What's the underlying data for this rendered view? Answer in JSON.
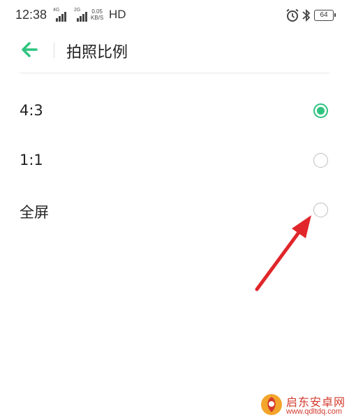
{
  "status_bar": {
    "time": "12:38",
    "signal_1_tag": "4G",
    "signal_2_tag": "2G",
    "speed_value": "0.05",
    "speed_unit": "KB/S",
    "hd_label": "HD",
    "battery_level": "64",
    "icons": [
      "alarm-icon",
      "bluetooth-icon",
      "battery-icon"
    ]
  },
  "header": {
    "title": "拍照比例",
    "back_icon": "arrow-left-icon"
  },
  "options": [
    {
      "label": "4:3",
      "selected": true
    },
    {
      "label": "1:1",
      "selected": false
    },
    {
      "label": "全屏",
      "selected": false
    }
  ],
  "watermark": {
    "name": "启东安卓网",
    "url": "www.qdltdq.com"
  },
  "colors": {
    "accent": "#2dc47e",
    "annotation": "#e0262a",
    "radio_off": "#bfbfbf",
    "watermark": "#d33a2c"
  }
}
